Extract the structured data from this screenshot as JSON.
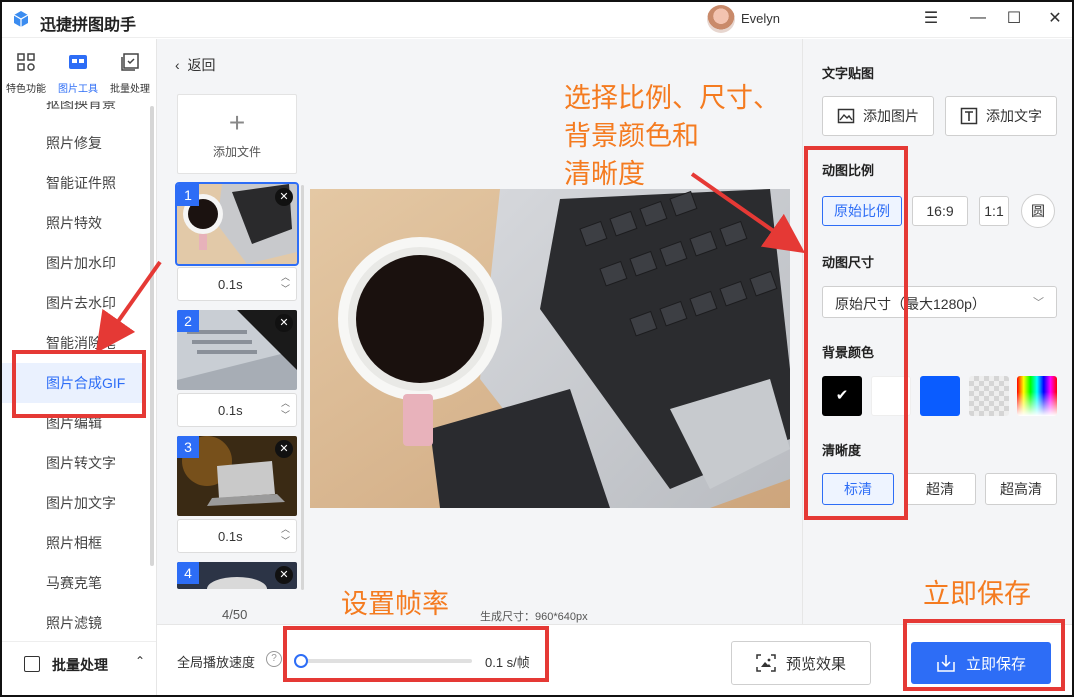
{
  "app": {
    "title": "迅捷拼图助手",
    "user_name": "Evelyn"
  },
  "window_controls": {
    "menu": "☰",
    "minimize": "—",
    "maximize": "☐",
    "close": "✕"
  },
  "top_tabs": [
    {
      "label": "特色功能",
      "icon": "grid-icon"
    },
    {
      "label": "图片工具",
      "icon": "toolbox-icon",
      "active": true
    },
    {
      "label": "批量处理",
      "icon": "batch-check-icon"
    }
  ],
  "left_menu": {
    "partial_top": "抠图换背景",
    "items": [
      "照片修复",
      "智能证件照",
      "照片特效",
      "图片加水印",
      "图片去水印",
      "智能消除笔",
      "图片合成GIF",
      "图片编辑",
      "图片转文字",
      "图片加文字",
      "照片相框",
      "马赛克笔",
      "照片滤镜"
    ],
    "active_item": "图片合成GIF",
    "bottom_section": "批量处理"
  },
  "middle": {
    "back_label": "返回",
    "add_file_label": "添加文件",
    "frames": [
      {
        "number": "1",
        "duration": "0.1s"
      },
      {
        "number": "2",
        "duration": "0.1s"
      },
      {
        "number": "3",
        "duration": "0.1s"
      },
      {
        "number": "4",
        "duration": ""
      }
    ],
    "count_text": "4/50",
    "gen_size_text": "生成尺寸：960*640px"
  },
  "annotations": {
    "ratio_note_line1": "选择比例、尺寸、",
    "ratio_note_line2": "背景颜色和",
    "ratio_note_line3": "清晰度",
    "framerate_note": "设置帧率",
    "save_note": "立即保存"
  },
  "right_panel": {
    "text_sticker_title": "文字贴图",
    "add_image_btn": "添加图片",
    "add_text_btn": "添加文字",
    "ratio_title": "动图比例",
    "ratio_options": [
      "原始比例",
      "16:9",
      "1:1",
      "圆"
    ],
    "ratio_selected": "原始比例",
    "size_title": "动图尺寸",
    "size_value": "原始尺寸（最大1280p）",
    "bg_title": "背景颜色",
    "bg_colors": [
      "#000000",
      "#ffffff",
      "#0a5cff",
      "transparent",
      "rainbow"
    ],
    "clarity_title": "清晰度",
    "clarity_options": [
      "标清",
      "超清",
      "超高清"
    ],
    "clarity_selected": "标清"
  },
  "bottom_bar": {
    "global_speed_label": "全局播放速度",
    "help_icon": "?",
    "speed_value": "0.1 s/帧",
    "speed_position": 0,
    "preview_btn": "预览效果",
    "save_btn": "立即保存"
  },
  "colors": {
    "accent": "#2d6df6",
    "annotation": "#f47b20",
    "highlight_box": "#e53935"
  }
}
